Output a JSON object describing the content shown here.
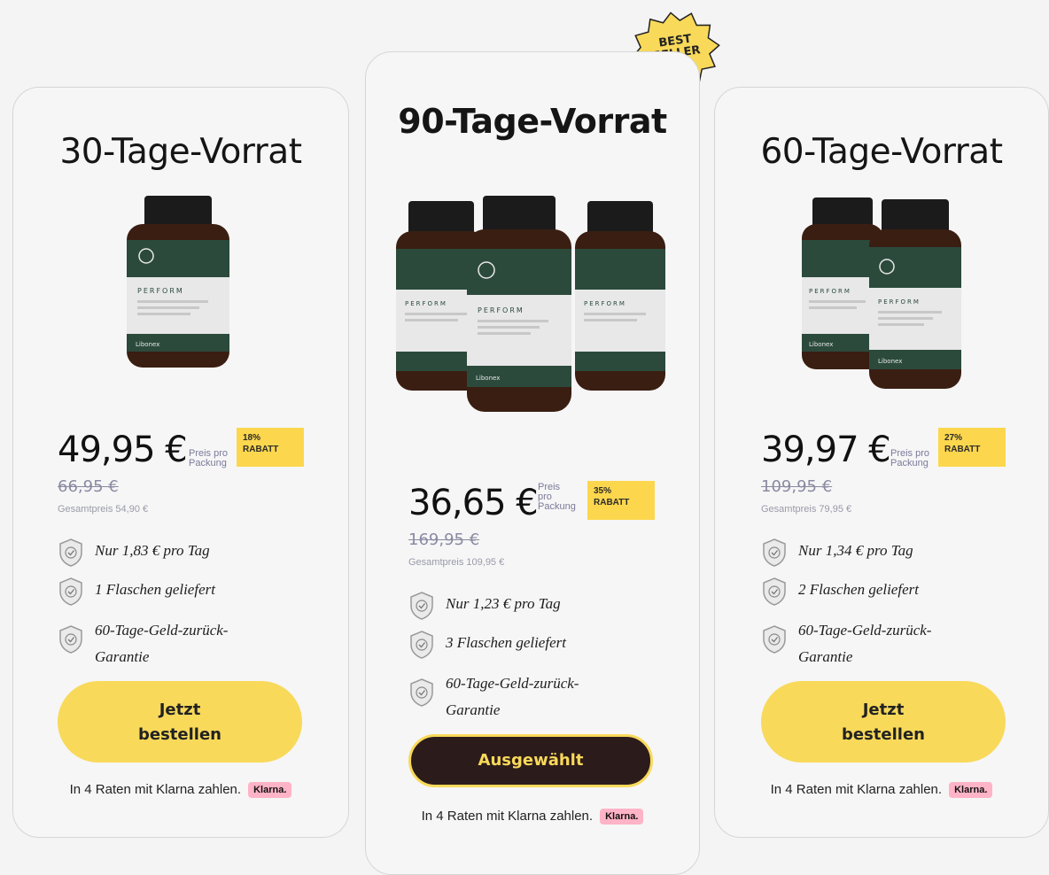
{
  "best_seller_badge": {
    "line1": "BEST",
    "line2": "SELLER"
  },
  "plans": {
    "p30": {
      "title": "30-Tage-Vorrat",
      "price": "49,95 €",
      "price_unit_line1": "Preis pro",
      "price_unit_line2": "Packung",
      "discount_pct": "18%",
      "discount_label": "RABATT",
      "old_price": "66,95 €",
      "total": "Gesamtpreis 54,90 €",
      "features": [
        "Nur 1,83  € pro Tag",
        "1 Flaschen geliefert",
        "60-Tage-Geld-zurück-Garantie"
      ],
      "button_line1": "Jetzt",
      "button_line2": "bestellen",
      "klarna_text": "In 4 Raten mit Klarna zahlen.",
      "klarna_badge": "Klarna.",
      "bottle_brand": "PERFORM",
      "bottle_maker": "Libonex",
      "bottle_count": 1
    },
    "p90": {
      "title": "90-Tage-Vorrat",
      "price": "36,65 €",
      "price_unit_line1": "Preis",
      "price_unit_line2": "pro",
      "price_unit_line3": "Packung",
      "discount_pct": "35%",
      "discount_label": "RABATT",
      "old_price": "169,95 €",
      "total": "Gesamtpreis 109,95 €",
      "features": [
        "Nur 1,23  € pro Tag",
        "3 Flaschen geliefert",
        "60-Tage-Geld-zurück-Garantie"
      ],
      "button_label": "Ausgewählt",
      "klarna_text": "In 4 Raten mit Klarna zahlen.",
      "klarna_badge": "Klarna.",
      "bottle_brand": "PERFORM",
      "bottle_maker": "Libonex",
      "bottle_count": 3
    },
    "p60": {
      "title": "60-Tage-Vorrat",
      "price": "39,97 €",
      "price_unit_line1": "Preis pro",
      "price_unit_line2": "Packung",
      "discount_pct": "27%",
      "discount_label": "RABATT",
      "old_price": "109,95 €",
      "total": "Gesamtpreis 79,95 €",
      "features": [
        "Nur 1,34  € pro Tag",
        "2 Flaschen geliefert",
        "60-Tage-Geld-zurück-Garantie"
      ],
      "button_line1": "Jetzt",
      "button_line2": "bestellen",
      "klarna_text": "In 4 Raten mit Klarna zahlen.",
      "klarna_badge": "Klarna.",
      "bottle_brand": "PERFORM",
      "bottle_maker": "Libonex",
      "bottle_count": 2
    }
  },
  "colors": {
    "accent_yellow": "#f8d95a",
    "selected_button": "#2c1b1b",
    "klarna_pink": "#ffb3c7",
    "bottle_green": "#2b4a3c",
    "bottle_amber": "#3a1e12"
  },
  "icons": {
    "feature": "shield-check-icon",
    "badge": "starburst-badge-icon"
  }
}
